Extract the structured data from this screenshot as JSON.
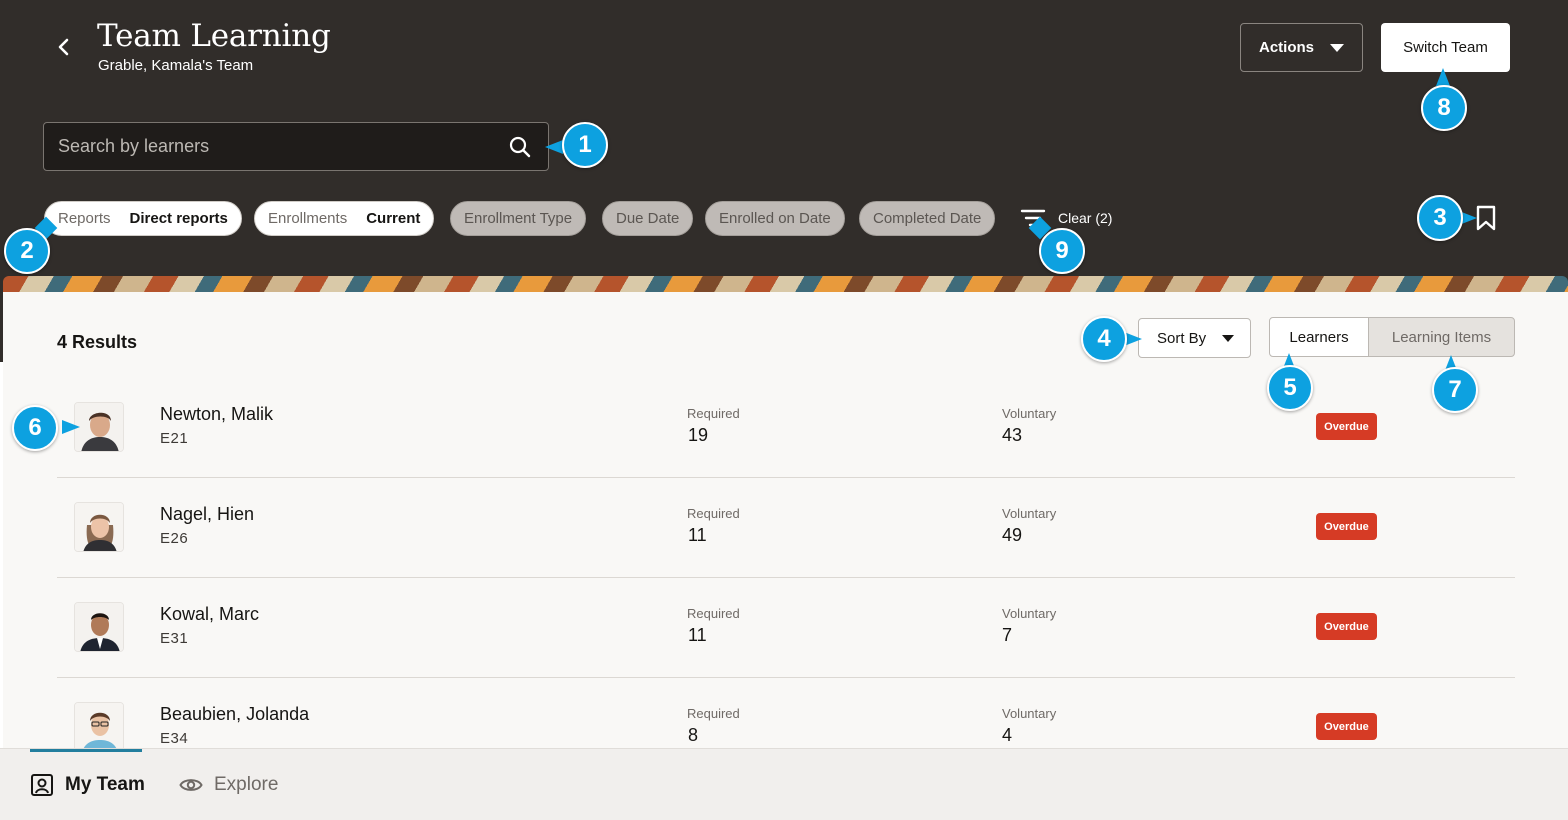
{
  "header": {
    "title": "Team Learning",
    "subtitle": "Grable, Kamala's Team",
    "actions_label": "Actions",
    "switch_team_label": "Switch Team"
  },
  "search": {
    "placeholder": "Search by learners"
  },
  "filters": {
    "chips": [
      {
        "label": "Reports",
        "value": "Direct reports",
        "active": true
      },
      {
        "label": "Enrollments",
        "value": "Current",
        "active": true
      },
      {
        "label": "Enrollment Type",
        "active": false
      },
      {
        "label": "Due Date",
        "active": false
      },
      {
        "label": "Enrolled on Date",
        "active": false
      },
      {
        "label": "Completed Date",
        "active": false
      }
    ],
    "clear_label": "Clear (2)"
  },
  "results": {
    "count_label": "4 Results",
    "sort_label": "Sort By",
    "view_toggle": {
      "learners": "Learners",
      "learning_items": "Learning Items",
      "selected": "Learners"
    }
  },
  "learners": [
    {
      "name": "Newton, Malik",
      "id": "E21",
      "required_label": "Required",
      "required": "19",
      "voluntary_label": "Voluntary",
      "voluntary": "43",
      "status": "Overdue"
    },
    {
      "name": "Nagel, Hien",
      "id": "E26",
      "required_label": "Required",
      "required": "11",
      "voluntary_label": "Voluntary",
      "voluntary": "49",
      "status": "Overdue"
    },
    {
      "name": "Kowal, Marc",
      "id": "E31",
      "required_label": "Required",
      "required": "11",
      "voluntary_label": "Voluntary",
      "voluntary": "7",
      "status": "Overdue"
    },
    {
      "name": "Beaubien, Jolanda",
      "id": "E34",
      "required_label": "Required",
      "required": "8",
      "voluntary_label": "Voluntary",
      "voluntary": "4",
      "status": "Overdue"
    }
  ],
  "footer": {
    "tabs": [
      {
        "label": "My Team",
        "icon": "team-icon",
        "selected": true
      },
      {
        "label": "Explore",
        "icon": "eye-icon",
        "selected": false
      }
    ]
  },
  "callouts": [
    "1",
    "2",
    "3",
    "4",
    "5",
    "6",
    "7",
    "8",
    "9"
  ],
  "colors": {
    "header_bg": "#312d2a",
    "overdue": "#d63b25",
    "callout": "#0da1e0",
    "accent": "#227e9e"
  }
}
